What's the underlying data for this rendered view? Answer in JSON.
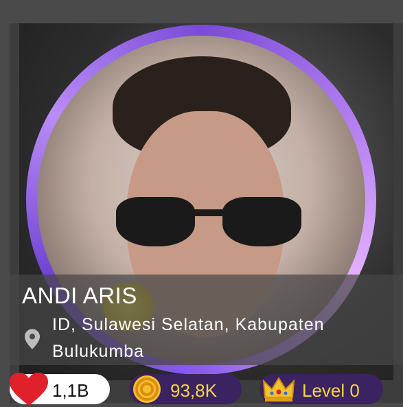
{
  "profile": {
    "name": "ANDI ARIS",
    "location": "ID, Sulawesi Selatan, Kabupaten Bulukumba"
  },
  "stats": {
    "likes": "1,1B",
    "coins": "93,8K",
    "level": "Level 0"
  },
  "icons": {
    "likes": "heart-icon",
    "coins": "coin-icon",
    "level": "crown-icon",
    "location": "location-pin-icon"
  },
  "colors": {
    "heart": "#e0202a",
    "chip_dark": "#3a2360",
    "chip_text": "#f4d53f",
    "avatar_ring": "#8a5cf0"
  }
}
